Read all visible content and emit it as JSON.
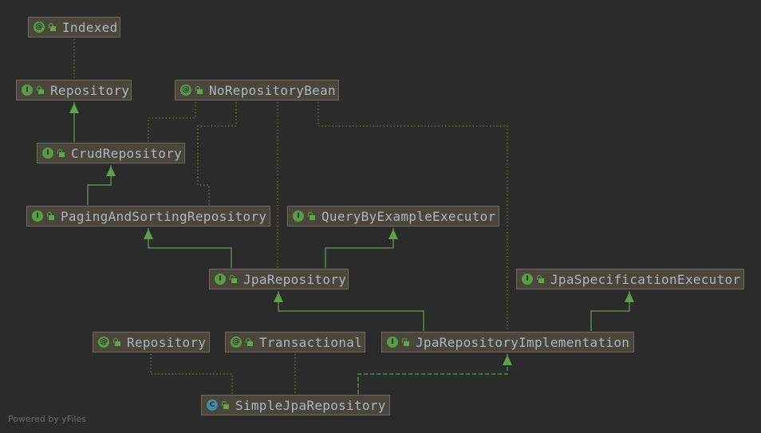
{
  "diagram": {
    "nodes": [
      {
        "id": "indexed",
        "label": "Indexed",
        "kind": "annotation",
        "kind_glyph": "@"
      },
      {
        "id": "repository",
        "label": "Repository",
        "kind": "interface",
        "kind_glyph": "I"
      },
      {
        "id": "norepositorybean",
        "label": "NoRepositoryBean",
        "kind": "annotation",
        "kind_glyph": "@"
      },
      {
        "id": "crudrepository",
        "label": "CrudRepository",
        "kind": "interface",
        "kind_glyph": "I"
      },
      {
        "id": "pagingandsortingrepository",
        "label": "PagingAndSortingRepository",
        "kind": "interface",
        "kind_glyph": "I"
      },
      {
        "id": "querybyexampleexecutor",
        "label": "QueryByExampleExecutor",
        "kind": "interface",
        "kind_glyph": "I"
      },
      {
        "id": "jparepository",
        "label": "JpaRepository",
        "kind": "interface",
        "kind_glyph": "I"
      },
      {
        "id": "jpaspecificationexecutor",
        "label": "JpaSpecificationExecutor",
        "kind": "interface",
        "kind_glyph": "I"
      },
      {
        "id": "repository-annotation",
        "label": "Repository",
        "kind": "annotation",
        "kind_glyph": "@"
      },
      {
        "id": "transactional",
        "label": "Transactional",
        "kind": "annotation",
        "kind_glyph": "@"
      },
      {
        "id": "jparepositoryimplementation",
        "label": "JpaRepositoryImplementation",
        "kind": "interface",
        "kind_glyph": "I"
      },
      {
        "id": "simplejparepository",
        "label": "SimpleJpaRepository",
        "kind": "class",
        "kind_glyph": "C"
      }
    ],
    "edges": [
      {
        "from": "indexed",
        "to": "repository",
        "type": "annotation"
      },
      {
        "from": "crudrepository",
        "to": "repository",
        "type": "extends"
      },
      {
        "from": "norepositorybean",
        "to": "crudrepository",
        "type": "annotation"
      },
      {
        "from": "norepositorybean",
        "to": "pagingandsortingrepository",
        "type": "annotation"
      },
      {
        "from": "norepositorybean",
        "to": "jparepository",
        "type": "annotation"
      },
      {
        "from": "norepositorybean",
        "to": "jparepositoryimplementation",
        "type": "annotation"
      },
      {
        "from": "pagingandsortingrepository",
        "to": "crudrepository",
        "type": "extends"
      },
      {
        "from": "jparepository",
        "to": "pagingandsortingrepository",
        "type": "extends"
      },
      {
        "from": "jparepository",
        "to": "querybyexampleexecutor",
        "type": "extends"
      },
      {
        "from": "jparepositoryimplementation",
        "to": "jparepository",
        "type": "extends"
      },
      {
        "from": "jparepositoryimplementation",
        "to": "jpaspecificationexecutor",
        "type": "extends"
      },
      {
        "from": "repository-annotation",
        "to": "simplejparepository",
        "type": "annotation"
      },
      {
        "from": "transactional",
        "to": "simplejparepository",
        "type": "annotation"
      },
      {
        "from": "simplejparepository",
        "to": "jparepositoryimplementation",
        "type": "implements"
      }
    ],
    "colors": {
      "background": "#2b2b2b",
      "node_fill": "#4a463c",
      "node_border": "#6e6b62",
      "node_text": "#a9b7c6",
      "interface_badge": "#5a9b45",
      "class_badge": "#3d8ea6",
      "extends_edge": "#5f9e4a",
      "annotation_edge": "#7f8030"
    }
  },
  "footer": {
    "text": "Powered by yFiles"
  }
}
